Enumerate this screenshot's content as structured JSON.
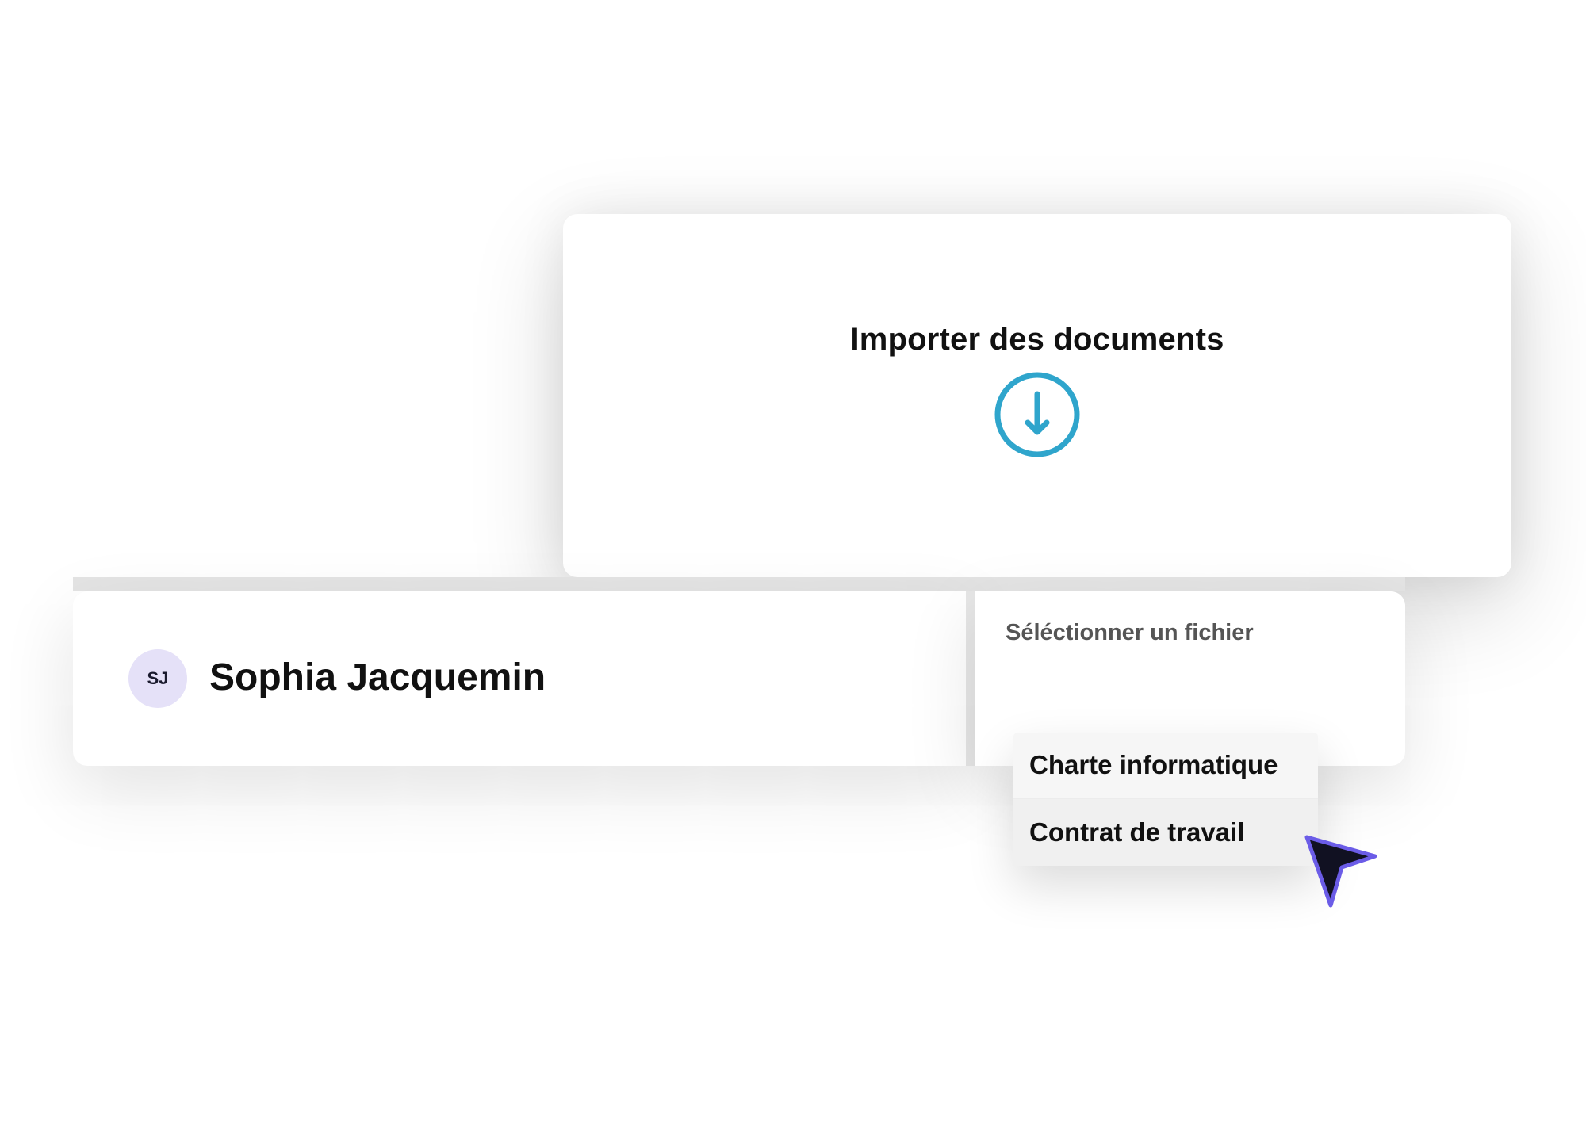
{
  "upload": {
    "title": "Importer des documents",
    "icon": "download-icon",
    "icon_color": "#2fa5cc"
  },
  "user": {
    "initials": "SJ",
    "name": "Sophia Jacquemin",
    "avatar_color": "#e5e1f8"
  },
  "file_select": {
    "label": "Séléctionner un fichier",
    "options": [
      {
        "label": "Charte informatique"
      },
      {
        "label": "Contrat de travail"
      }
    ]
  },
  "cursor": {
    "icon": "pointer-cursor-icon",
    "fill_color": "#111122",
    "stroke_color": "#6b5ce7"
  }
}
